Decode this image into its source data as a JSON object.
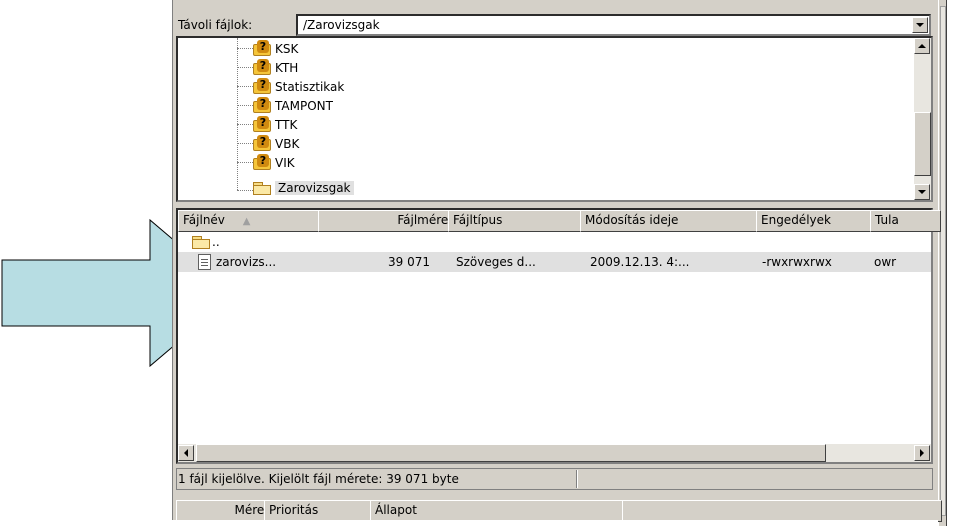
{
  "remote": {
    "label": "Távoli fájlok:",
    "path": "/Zarovizsgak"
  },
  "tree": {
    "items": [
      {
        "name": "KSK",
        "icon": "unknown-folder-icon"
      },
      {
        "name": "KTH",
        "icon": "unknown-folder-icon"
      },
      {
        "name": "Statisztikak",
        "icon": "unknown-folder-icon"
      },
      {
        "name": "TAMPONT",
        "icon": "unknown-folder-icon"
      },
      {
        "name": "TTK",
        "icon": "unknown-folder-icon"
      },
      {
        "name": "VBK",
        "icon": "unknown-folder-icon"
      },
      {
        "name": "VIK",
        "icon": "unknown-folder-icon"
      },
      {
        "name": "Zarovizsgak",
        "icon": "open-folder-icon",
        "selected": true
      }
    ]
  },
  "list": {
    "columns": [
      "Fájlnév",
      "Fájlméret",
      "Fájltípus",
      "Módosítás ideje",
      "Engedélyek",
      "Tula"
    ],
    "parent_row": "..",
    "rows": [
      {
        "name": "zarovizs...",
        "size": "39 071",
        "type": "Szöveges d...",
        "modified": "2009.12.13. 4:...",
        "permissions": "-rwxrwxrwx",
        "owner": "owr"
      }
    ]
  },
  "status": {
    "text": "1 fájl kijelölve. Kijelölt fájl mérete: 39 071 byte"
  },
  "queue": {
    "columns": [
      "Méret",
      "Prioritás",
      "Állapot"
    ]
  },
  "colors": {
    "arrow_fill": "#b7dde3",
    "window_bg": "#d4d0c8",
    "selection": "#e0e0e0"
  }
}
